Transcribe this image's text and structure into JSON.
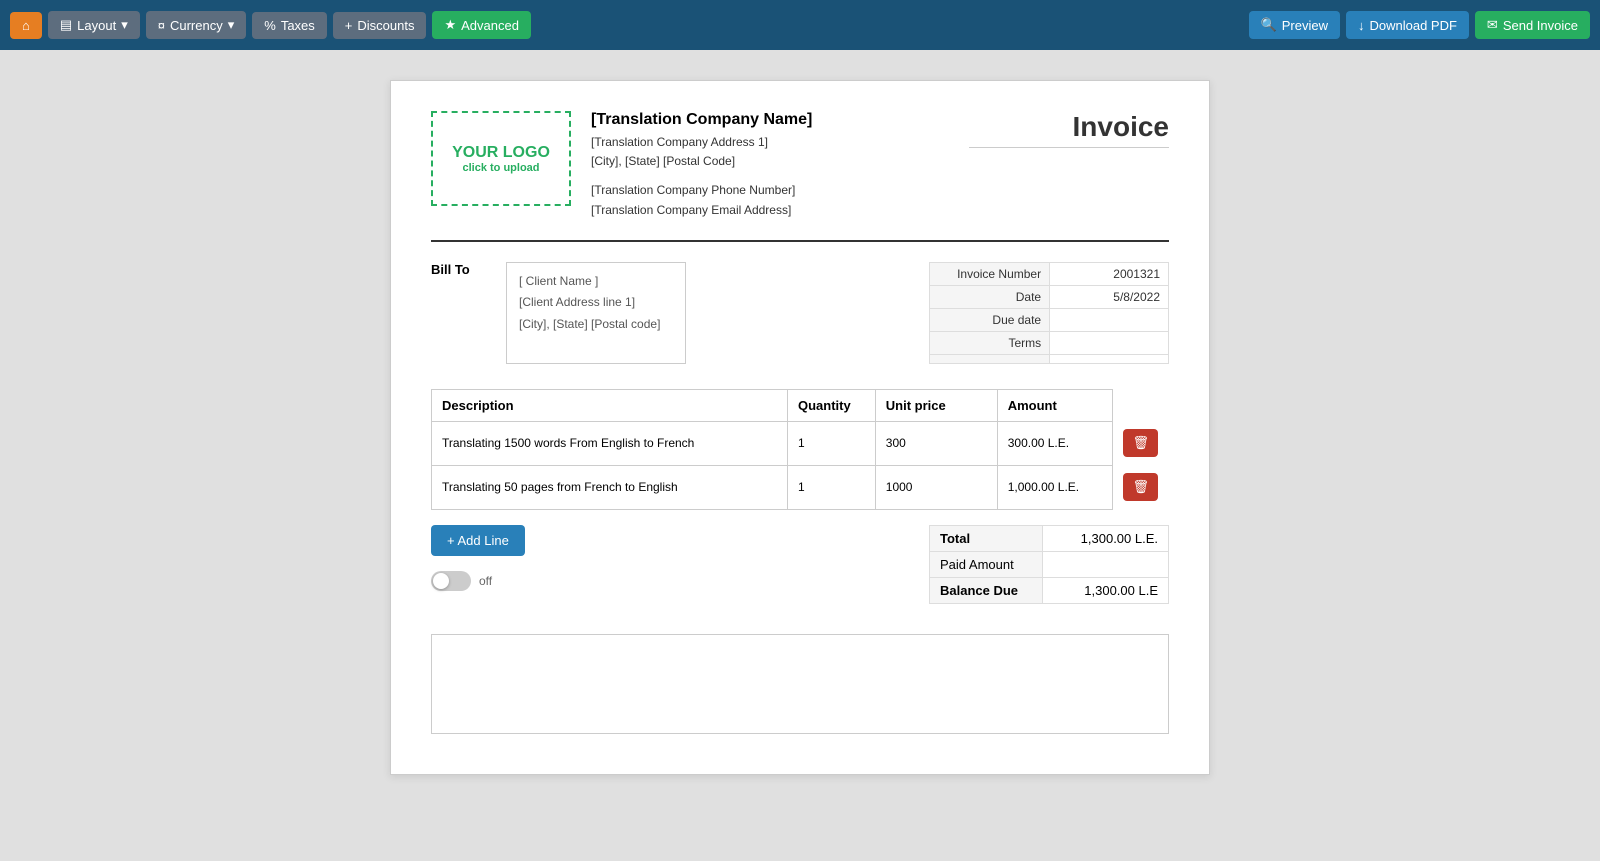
{
  "toolbar": {
    "home_label": "⌂",
    "layout_label": "Layout",
    "currency_label": "Currency",
    "taxes_label": "Taxes",
    "discounts_label": "Discounts",
    "advanced_label": "Advanced",
    "preview_label": "Preview",
    "download_label": "Download PDF",
    "send_label": "Send Invoice"
  },
  "invoice": {
    "logo_text": "YOUR LOGO",
    "logo_hint": "click to upload",
    "title": "Invoice",
    "company": {
      "name": "[Translation Company Name]",
      "address1": "[Translation Company Address 1]",
      "city_state": "[City], [State] [Postal Code]",
      "phone": "[Translation Company Phone Number]",
      "email": "[Translation Company Email Address]"
    },
    "bill_to_label": "Bill To",
    "client": {
      "name": "[ Client Name ]",
      "address1": "[Client Address line 1]",
      "city_state": "[City], [State] [Postal code]"
    },
    "details": {
      "invoice_number_label": "Invoice Number",
      "invoice_number_value": "2001321",
      "date_label": "Date",
      "date_value": "5/8/2022",
      "due_date_label": "Due date",
      "due_date_value": "",
      "terms_label": "Terms",
      "terms_value": ""
    },
    "table_headers": {
      "description": "Description",
      "quantity": "Quantity",
      "unit_price": "Unit price",
      "amount": "Amount"
    },
    "line_items": [
      {
        "description": "Translating 1500 words From English to French",
        "quantity": "1",
        "unit_price": "300",
        "amount": "300.00 L.E."
      },
      {
        "description": "Translating 50 pages from French to English",
        "quantity": "1",
        "unit_price": "1000",
        "amount": "1,000.00 L.E."
      }
    ],
    "add_line_label": "+ Add Line",
    "toggle_label": "off",
    "total_label": "Total",
    "total_value": "1,300.00 L.E.",
    "paid_amount_label": "Paid Amount",
    "paid_amount_value": "",
    "balance_due_label": "Balance Due",
    "balance_due_value": "1,300.00 L.E"
  }
}
